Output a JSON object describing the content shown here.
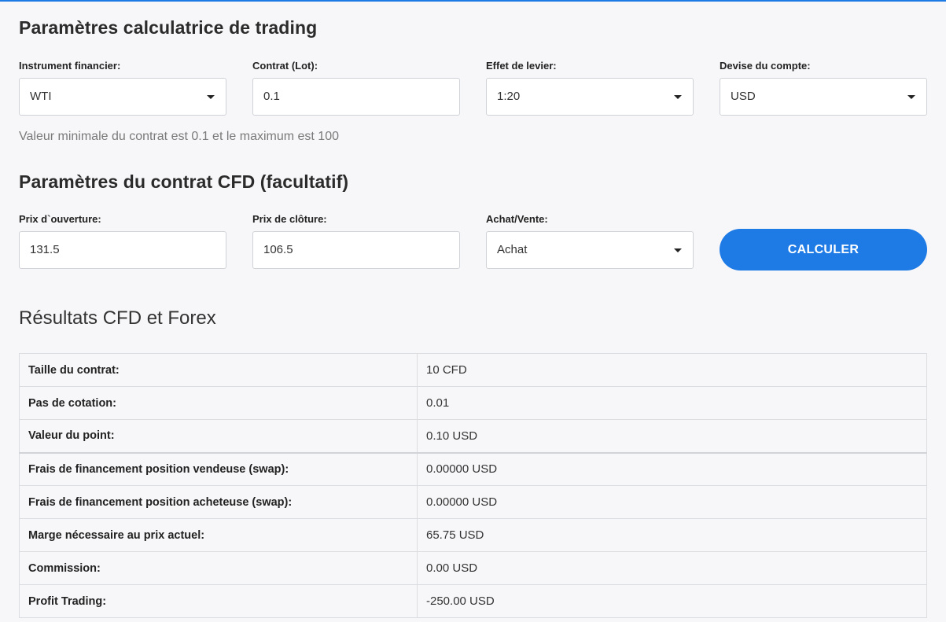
{
  "section1": {
    "title": "Paramètres calculatrice de trading",
    "fields": {
      "instrument": {
        "label": "Instrument financier:",
        "value": "WTI"
      },
      "contract": {
        "label": "Contrat (Lot):",
        "value": "0.1"
      },
      "leverage": {
        "label": "Effet de levier:",
        "value": "1:20"
      },
      "currency": {
        "label": "Devise du compte:",
        "value": "USD"
      }
    },
    "hint": "Valeur minimale du contrat est 0.1 et le maximum est 100"
  },
  "section2": {
    "title": "Paramètres du contrat CFD (facultatif)",
    "fields": {
      "open_price": {
        "label": "Prix d`ouverture:",
        "value": "131.5"
      },
      "close_price": {
        "label": "Prix de clôture:",
        "value": "106.5"
      },
      "side": {
        "label": "Achat/Vente:",
        "value": "Achat"
      }
    },
    "calculate_label": "CALCULER"
  },
  "results": {
    "title": "Résultats CFD et Forex",
    "rows": [
      {
        "key": "Taille du contrat:",
        "value": "10 CFD"
      },
      {
        "key": "Pas de cotation:",
        "value": "0.01"
      },
      {
        "key": "Valeur du point:",
        "value": "0.10 USD"
      },
      {
        "key": "Frais de financement position vendeuse (swap):",
        "value": "0.00000 USD"
      },
      {
        "key": "Frais de financement position acheteuse (swap):",
        "value": "0.00000 USD"
      },
      {
        "key": "Marge nécessaire au prix actuel:",
        "value": "65.75 USD"
      },
      {
        "key": "Commission:",
        "value": "0.00 USD"
      },
      {
        "key": "Profit Trading:",
        "value": "-250.00 USD"
      }
    ]
  },
  "colors": {
    "accent": "#1e7be6",
    "background": "#f7f7f9"
  }
}
